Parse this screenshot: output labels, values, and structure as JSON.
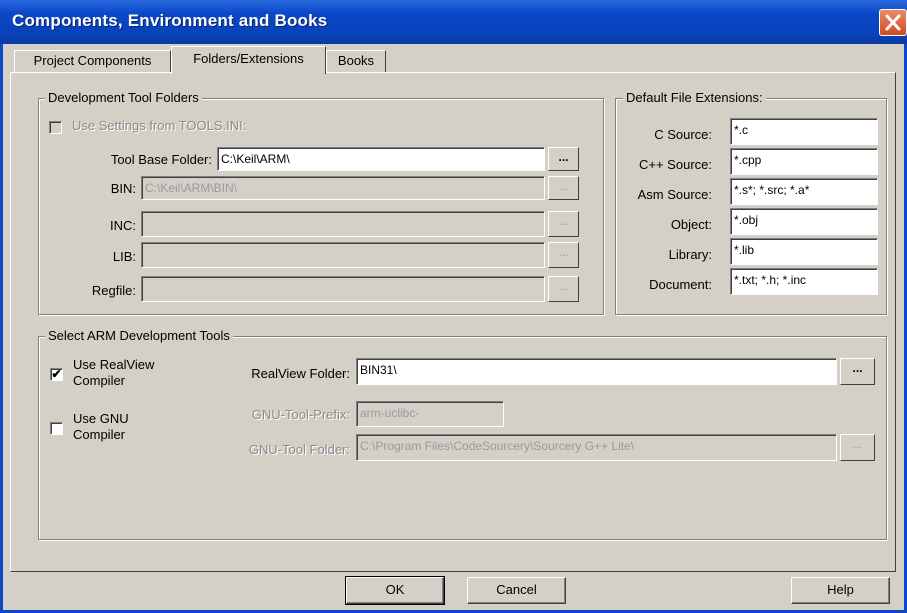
{
  "window": {
    "title": "Components, Environment and Books"
  },
  "tabs": [
    {
      "label": "Project Components"
    },
    {
      "label": "Folders/Extensions"
    },
    {
      "label": "Books"
    }
  ],
  "dev_tool_folders": {
    "legend": "Development Tool Folders",
    "use_settings_label": "Use Settings from TOOLS.INI:",
    "use_settings_checked": false,
    "tool_base_label": "Tool Base Folder:",
    "tool_base_value": "C:\\Keil\\ARM\\",
    "bin_label": "BIN:",
    "bin_value": "C:\\Keil\\ARM\\BIN\\",
    "inc_label": "INC:",
    "inc_value": "",
    "lib_label": "LIB:",
    "lib_value": "",
    "regfile_label": "Regfile:",
    "regfile_value": "",
    "browse_label": "..."
  },
  "default_extensions": {
    "legend": "Default File Extensions:",
    "rows": [
      {
        "label": "C Source:",
        "value": "*.c"
      },
      {
        "label": "C++ Source:",
        "value": "*.cpp"
      },
      {
        "label": "Asm Source:",
        "value": "*.s*; *.src; *.a*"
      },
      {
        "label": "Object:",
        "value": "*.obj"
      },
      {
        "label": "Library:",
        "value": "*.lib"
      },
      {
        "label": "Document:",
        "value": "*.txt; *.h; *.inc"
      }
    ]
  },
  "arm_tools": {
    "legend": "Select ARM Development Tools",
    "use_realview_label_1": "Use RealView",
    "use_realview_label_2": "Compiler",
    "use_realview_checked": "✔",
    "use_gnu_label_1": "Use GNU",
    "use_gnu_label_2": "Compiler",
    "realview_folder_label": "RealView Folder:",
    "realview_folder_value": "BIN31\\",
    "gnu_prefix_label": "GNU-Tool-Prefix:",
    "gnu_prefix_value": "arm-uclibc-",
    "gnu_folder_label": "GNU-Tool Folder:",
    "gnu_folder_value": "C:\\Program Files\\CodeSourcery\\Sourcery G++ Lite\\"
  },
  "buttons": {
    "ok": "OK",
    "cancel": "Cancel",
    "help": "Help"
  }
}
